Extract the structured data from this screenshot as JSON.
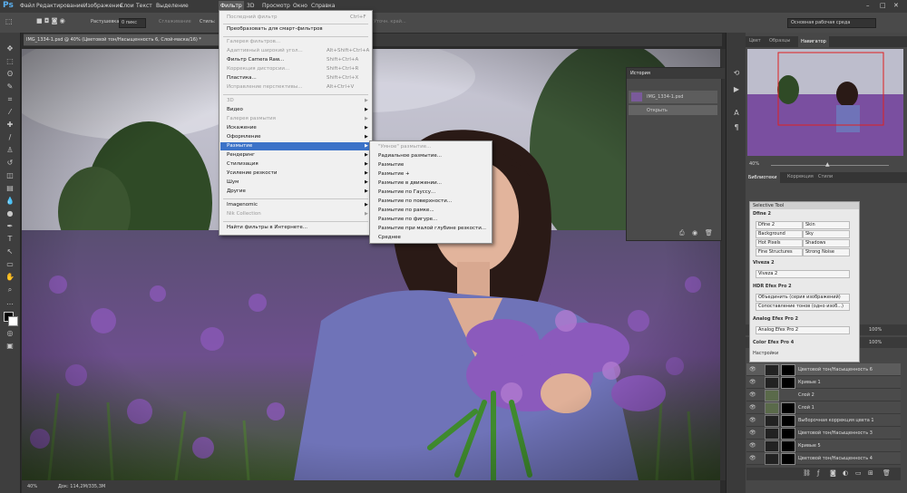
{
  "app": {
    "logo": "Ps"
  },
  "menubar": {
    "items": [
      "Файл",
      "Редактирование",
      "Изображение",
      "Слои",
      "Текст",
      "Выделение",
      "Фильтр",
      "3D",
      "Просмотр",
      "Окно",
      "Справка"
    ],
    "active": "Фильтр"
  },
  "optionsbar": {
    "feather_label": "Растушевка:",
    "feather_value": "0 пикс",
    "smoothing_label": "Сглаживание",
    "style_label": "Стиль:",
    "refine_label": "Уточн. край...",
    "workspace": "Основная рабочая среда"
  },
  "document": {
    "tab": "IMG_1334-1.psd @ 40% (Цветовой тон/Насыщенность 6, Слой-маска/16) *"
  },
  "status": {
    "zoom": "40%",
    "doc": "Док: 114,2M/335,3M"
  },
  "filter_menu": {
    "items": [
      {
        "label": "Последний фильтр",
        "shortcut": "Ctrl+F",
        "disabled": true
      },
      {
        "label": "Преобразовать для смарт-фильтров",
        "disabled": false
      },
      {
        "label": "Галерея фильтров...",
        "disabled": true
      },
      {
        "label": "Адаптивный широкий угол...",
        "shortcut": "Alt+Shift+Ctrl+A",
        "disabled": true
      },
      {
        "label": "Фильтр Camera Raw...",
        "shortcut": "Shift+Ctrl+A",
        "disabled": false
      },
      {
        "label": "Коррекция дисторсии...",
        "shortcut": "Shift+Ctrl+R",
        "disabled": true
      },
      {
        "label": "Пластика...",
        "shortcut": "Shift+Ctrl+X",
        "disabled": false
      },
      {
        "label": "Исправление перспективы...",
        "shortcut": "Alt+Ctrl+V",
        "disabled": true
      },
      {
        "label": "3D",
        "submenu": true,
        "disabled": true
      },
      {
        "label": "Видео",
        "submenu": true,
        "disabled": false
      },
      {
        "label": "Галерея размытия",
        "submenu": true,
        "disabled": true
      },
      {
        "label": "Искажение",
        "submenu": true,
        "disabled": false
      },
      {
        "label": "Оформление",
        "submenu": true,
        "disabled": false
      },
      {
        "label": "Размытие",
        "submenu": true,
        "disabled": false,
        "highlight": true
      },
      {
        "label": "Рендеринг",
        "submenu": true,
        "disabled": false
      },
      {
        "label": "Стилизация",
        "submenu": true,
        "disabled": false
      },
      {
        "label": "Усиление резкости",
        "submenu": true,
        "disabled": false
      },
      {
        "label": "Шум",
        "submenu": true,
        "disabled": false
      },
      {
        "label": "Другие",
        "submenu": true,
        "disabled": false
      },
      {
        "label": "Imagenomic",
        "submenu": true,
        "disabled": false
      },
      {
        "label": "Nik Collection",
        "submenu": true,
        "disabled": true
      },
      {
        "label": "Найти фильтры в Интернете...",
        "disabled": false
      }
    ]
  },
  "blur_submenu": {
    "items": [
      {
        "label": "\"Умное\" размытие...",
        "disabled": true
      },
      {
        "label": "Радиальное размытие...",
        "disabled": false
      },
      {
        "label": "Размытие",
        "disabled": false
      },
      {
        "label": "Размытие +",
        "disabled": false
      },
      {
        "label": "Размытие в движении...",
        "disabled": false
      },
      {
        "label": "Размытие по Гауссу...",
        "disabled": false
      },
      {
        "label": "Размытие по поверхности...",
        "disabled": false
      },
      {
        "label": "Размытие по рамке...",
        "disabled": false
      },
      {
        "label": "Размытие по фигуре...",
        "disabled": false
      },
      {
        "label": "Размытие при малой глубине резкости...",
        "disabled": false
      },
      {
        "label": "Среднее",
        "disabled": false
      }
    ]
  },
  "history": {
    "title": "История",
    "snapshot": "IMG_1334-1.psd",
    "op": "Открыть"
  },
  "navigator": {
    "tabs": [
      "Цвет",
      "Образцы",
      "Навигатор"
    ],
    "active": "Навигатор",
    "zoom": "40%"
  },
  "libraries": {
    "tabs": [
      "Библиотеки",
      "Коррекция",
      "Стили"
    ],
    "active": "Библиотеки"
  },
  "nik": {
    "title": "Selective Tool",
    "sections": [
      {
        "name": "Dfine 2",
        "cells": [
          "Dfine 2",
          "Skin",
          "Background",
          "Sky",
          "Hot Pixels",
          "Shadows",
          "Fine Structures",
          "Strong Noise"
        ]
      },
      {
        "name": "Viveza 2",
        "cells": [
          "Viveza 2"
        ]
      },
      {
        "name": "HDR Efex Pro 2",
        "cells": [
          "Объединить (серия изображений)",
          "Сопоставление тонов (одно изоб...)"
        ]
      },
      {
        "name": "Analog Efex Pro 2",
        "cells": [
          "Analog Efex Pro 2"
        ]
      },
      {
        "name": "Color Efex Pro 4",
        "cells": []
      }
    ],
    "settings": "Настройки"
  },
  "layers": {
    "items": [
      {
        "name": "Цветовой тон/Насыщенность 6",
        "selected": true
      },
      {
        "name": "Кривые 1"
      },
      {
        "name": "Слой 2"
      },
      {
        "name": "Слой 1"
      },
      {
        "name": "Выборочная коррекция цвета 1"
      },
      {
        "name": "Цветовой тон/Насыщенность 3"
      },
      {
        "name": "Кривые 5"
      },
      {
        "name": "Цветовой тон/Насыщенность 4"
      }
    ],
    "opacity": "100%",
    "fill": "100%"
  }
}
